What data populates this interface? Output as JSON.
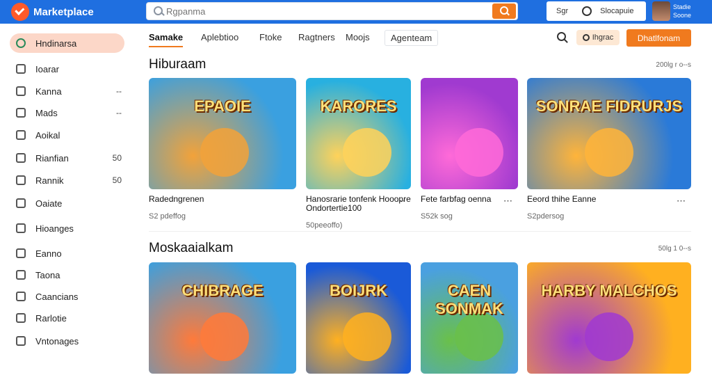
{
  "app": {
    "name": "Marketplace"
  },
  "search": {
    "placeholder": "Rgpanma"
  },
  "topbar": {
    "sg": "Sgr",
    "sign": "Slocapuie",
    "user_line1": "Stadie",
    "user_line2": "Soone"
  },
  "sidebar": {
    "items": [
      {
        "label": "Hndinarsa",
        "badge": ""
      },
      {
        "label": "Ioarar",
        "badge": ""
      },
      {
        "label": "Kanna",
        "badge": "--"
      },
      {
        "label": "Mads",
        "badge": "--"
      },
      {
        "label": "Aoikal",
        "badge": ""
      },
      {
        "label": "Rianfian",
        "badge": "50"
      },
      {
        "label": "Rannik",
        "badge": "50"
      },
      {
        "label": "Oaiate",
        "badge": ""
      },
      {
        "label": "Hioanges",
        "badge": ""
      },
      {
        "label": "Eanno",
        "badge": ""
      },
      {
        "label": "Taona",
        "badge": ""
      },
      {
        "label": "Caancians",
        "badge": ""
      },
      {
        "label": "Rarlotie",
        "badge": ""
      },
      {
        "label": "Vntonages",
        "badge": ""
      }
    ]
  },
  "tabs": [
    "Samake",
    "Aplebtioo",
    "Ftoke",
    "Ragtners",
    "Moojs",
    "Agenteam"
  ],
  "toolbar": {
    "chip_label": "Ihgrac",
    "cta_label": "Dhatlfonam"
  },
  "sections": [
    {
      "title": "Hiburaam",
      "meta": "200lg r o--s",
      "cards": [
        {
          "thumb_text": "EPAOIE",
          "title": "Radedngrenen",
          "sub": "S2 pdeffog",
          "colors": [
            "#3aa0e0",
            "#f2a23a"
          ]
        },
        {
          "thumb_text": "KARORES",
          "title": "Hanosrarie tonfenk Hooopre Ondortertie100",
          "sub": "50peeoffo)",
          "colors": [
            "#28b0e0",
            "#ffd25a"
          ]
        },
        {
          "thumb_text": "",
          "title": "Fete farbfag oenna",
          "sub": "S52k sog",
          "colors": [
            "#a03ad0",
            "#ff6ad8"
          ]
        },
        {
          "thumb_text": "SONRAE FIDRURJS",
          "title": "Eeord thihe Eanne",
          "sub": "S2pdersog",
          "colors": [
            "#2a7ad8",
            "#ffb43a"
          ]
        }
      ]
    },
    {
      "title": "Moskaaialkam",
      "meta": "50lg 1 0--s",
      "cards": [
        {
          "thumb_text": "CHIBRAGE",
          "title": "",
          "sub": "",
          "colors": [
            "#3aa0e0",
            "#ff7a3a"
          ]
        },
        {
          "thumb_text": "BOIJRK",
          "title": "",
          "sub": "",
          "colors": [
            "#1a5ad8",
            "#ffb020"
          ]
        },
        {
          "thumb_text": "CAEN SONMAK",
          "title": "",
          "sub": "",
          "colors": [
            "#4aa0e0",
            "#6ac04a"
          ]
        },
        {
          "thumb_text": "HARBY MALCHOS",
          "title": "",
          "sub": "",
          "colors": [
            "#ffb020",
            "#a03ad0"
          ]
        }
      ]
    }
  ]
}
